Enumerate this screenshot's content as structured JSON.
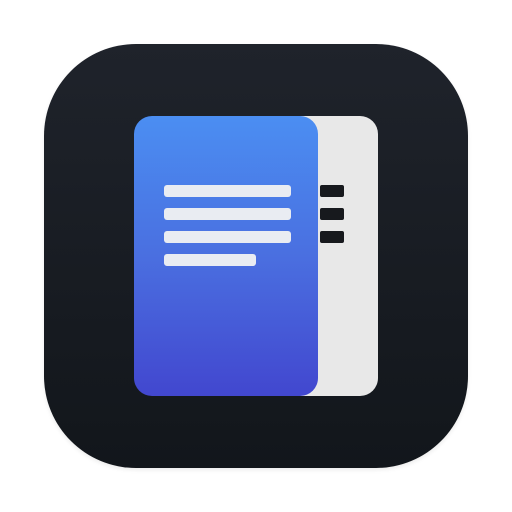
{
  "app_icon": {
    "icon": "document-icon",
    "colors": {
      "tile_dark": "#1a1e24",
      "front_page_top": "#4b8ef2",
      "front_page_bottom": "#4247cf",
      "back_page": "#e8e8e8",
      "text_lines": "#e9ecf2"
    }
  }
}
